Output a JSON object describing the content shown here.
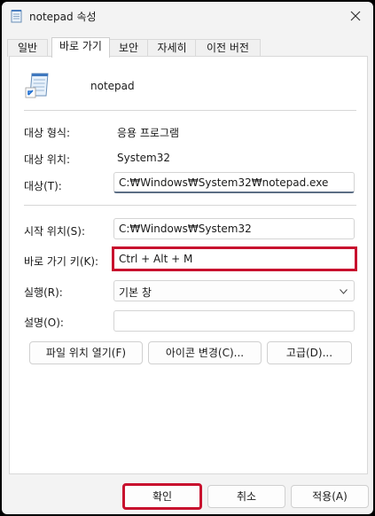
{
  "window": {
    "title": "notepad 속성"
  },
  "tabs": [
    {
      "label": "일반"
    },
    {
      "label": "바로 가기"
    },
    {
      "label": "보안"
    },
    {
      "label": "자세히"
    },
    {
      "label": "이전 버전"
    }
  ],
  "header": {
    "name": "notepad"
  },
  "info": {
    "target_type_label": "대상 형식:",
    "target_type_value": "응용 프로그램",
    "target_location_label": "대상 위치:",
    "target_location_value": "System32"
  },
  "target": {
    "label": "대상(T):",
    "value": "C:₩Windows₩System32₩notepad.exe"
  },
  "start_in": {
    "label": "시작 위치(S):",
    "value": "C:₩Windows₩System32"
  },
  "shortcut_key": {
    "label": "바로 가기 키(K):",
    "value": "Ctrl + Alt + M"
  },
  "run": {
    "label": "실행(R):",
    "value": "기본 창"
  },
  "comment": {
    "label": "설명(O):",
    "value": ""
  },
  "buttons": {
    "open_location": "파일 위치 열기(F)",
    "change_icon": "아이콘 변경(C)...",
    "advanced": "고급(D)..."
  },
  "footer": {
    "ok": "확인",
    "cancel": "취소",
    "apply": "적용(A)"
  },
  "colors": {
    "highlight": "#c8102e",
    "focus_underline": "#5c6e85"
  }
}
